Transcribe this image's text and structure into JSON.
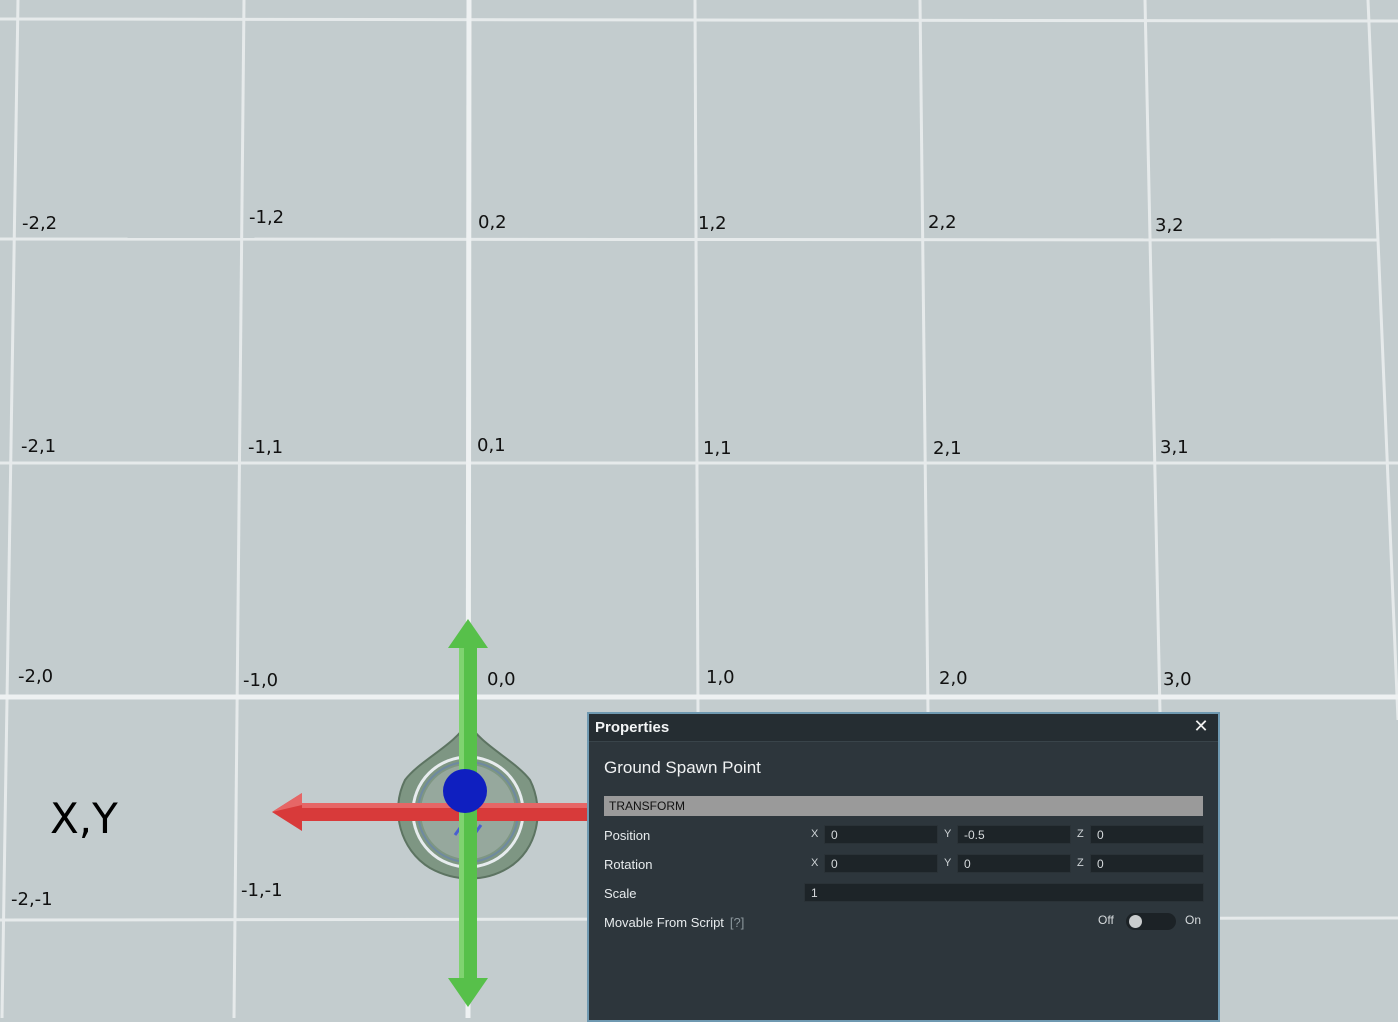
{
  "viewport": {
    "axis_label": "X,Y",
    "grid_labels": [
      "-2,2",
      "-1,2",
      "0,2",
      "1,2",
      "2,2",
      "3,2",
      "-2,1",
      "-1,1",
      "0,1",
      "1,1",
      "2,1",
      "3,1",
      "-2,0",
      "-1,0",
      "0,0",
      "1,0",
      "2,0",
      "3,0",
      "-2,-1",
      "-1,-1"
    ],
    "gizmo": {
      "x_axis_color": "#d83a3a",
      "y_axis_color": "#57c04a",
      "pivot_color": "#0f1fc0"
    }
  },
  "panel": {
    "title": "Properties",
    "close_icon": "close-icon",
    "object_name": "Ground Spawn Point",
    "section": "TRANSFORM",
    "position": {
      "label": "Position",
      "x_label": "X",
      "y_label": "Y",
      "z_label": "Z",
      "x": "0",
      "y": "-0.5",
      "z": "0"
    },
    "rotation": {
      "label": "Rotation",
      "x_label": "X",
      "y_label": "Y",
      "z_label": "Z",
      "x": "0",
      "y": "0",
      "z": "0"
    },
    "scale": {
      "label": "Scale",
      "value": "1"
    },
    "movable": {
      "label": "Movable From Script",
      "hint": "[?]",
      "off_label": "Off",
      "on_label": "On",
      "state": "off"
    },
    "accent_color": "#6f99b1"
  }
}
